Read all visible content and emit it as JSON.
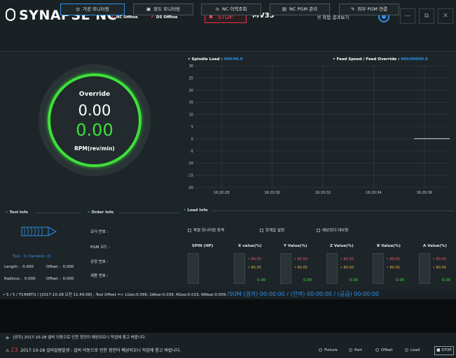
{
  "header": {
    "logo": "SYNAPSE NC",
    "nc_status": "NC Offline",
    "ds_status": "DS Offline",
    "run_state": "STOP",
    "machine": "MV33",
    "worklog_label": "작업 결과보기",
    "minimize": "—",
    "restore": "⧉",
    "close": "✕"
  },
  "tabs": [
    {
      "icon": "◎",
      "label": "가공 모니터링",
      "active": true
    },
    {
      "icon": "▣",
      "label": "정도 모니터링",
      "active": false
    },
    {
      "icon": "⊙",
      "label": "NC 이력조회",
      "active": false
    },
    {
      "icon": "▤",
      "label": "NC PGM 관리",
      "active": false
    },
    {
      "icon": "✎",
      "label": "외부 PGM 연결",
      "active": false
    }
  ],
  "override": {
    "label": "Override",
    "value1": "0.00",
    "value2": "0.00",
    "unit": "RPM(rev/min)"
  },
  "chart_data": {
    "type": "line",
    "series": [
      {
        "name": "Spindle Load : ",
        "values_label": "000/00.0"
      },
      {
        "name": "Feed Speed / Feed Override : ",
        "values_label": "000/00000.0"
      }
    ],
    "x": [
      "16:20:28",
      "16:20:30",
      "16:20:32",
      "16:20:34",
      "16:20:36"
    ],
    "ylim": [
      -20,
      30
    ],
    "yticks": [
      "30",
      "25",
      "20",
      "15",
      "10",
      "5",
      "0",
      "-5",
      "-10",
      "-15",
      "-20"
    ],
    "line_y": 0,
    "line_start_x": 4,
    "grid": true,
    "colors": {
      "line": "#d9dfe2",
      "grid": "#3a4448"
    }
  },
  "tool_info": {
    "title": "Tool Info",
    "tool_label": "Tool :",
    "tool_value": "0 (Variable: 0)",
    "length_label": "Length :",
    "length_value": "0.000",
    "offset1_label": "Offset :",
    "offset1_value": "0.000",
    "radius_label": "Radious :",
    "radius_value": "0.000",
    "offset2_label": "Offset :",
    "offset2_value": "0.000"
  },
  "order_info": {
    "title": "Order Info",
    "fields": [
      "오더 번호 :",
      "PGM 코드 :",
      "공정 번호 :",
      "제품 번호 :"
    ]
  },
  "load_info": {
    "title": "Load Info",
    "checks": [
      "파형 모니터링 창색",
      "한계값 설정",
      "예상정지 대사원"
    ],
    "columns": [
      {
        "head": "SPIN (HP)",
        "v1": "",
        "v2": "",
        "v3": ""
      },
      {
        "head": "X value(%)",
        "v1": "80.00",
        "v2": "80.00",
        "v3": "0.00"
      },
      {
        "head": "Y Value(%)",
        "v1": "80.00",
        "v2": "80.00",
        "v3": "0.00"
      },
      {
        "head": "Z Value(%)",
        "v1": "80.00",
        "v2": "80.00",
        "v3": "0.00"
      },
      {
        "head": "B Value(%)",
        "v1": "80.00",
        "v2": "80.00",
        "v3": "0.00"
      },
      {
        "head": "A Value(%)",
        "v1": "80.00",
        "v2": "80.00",
        "v3": "0.00"
      }
    ]
  },
  "status_line": {
    "text": "• 5 / 5 /  T1498TU  /  [2017-10-28 오전 11:49:58]  :  Tool Offset =>  LGeo:0.096, LWear:0.039, RGeo:0.019, RWear:0.009",
    "sum": "/SUM (경과) 00:00:00 / (잔여) 00:00:00 / (공급) 00:00:00"
  },
  "notice": {
    "text": "[공지] 2017-10-28 설비 이동으로 인한 정전이 예상되오니 작업에 참고 바랍니다."
  },
  "alarm": {
    "count": "23",
    "text": "2017-10-28 설비알람발생 : 설비 이동으로 인한 정전이 예상되오니 작업에 참고 바랍니다.",
    "options": [
      "Fixture",
      "Part",
      "Offset",
      "Load"
    ],
    "stop": "STOP"
  }
}
